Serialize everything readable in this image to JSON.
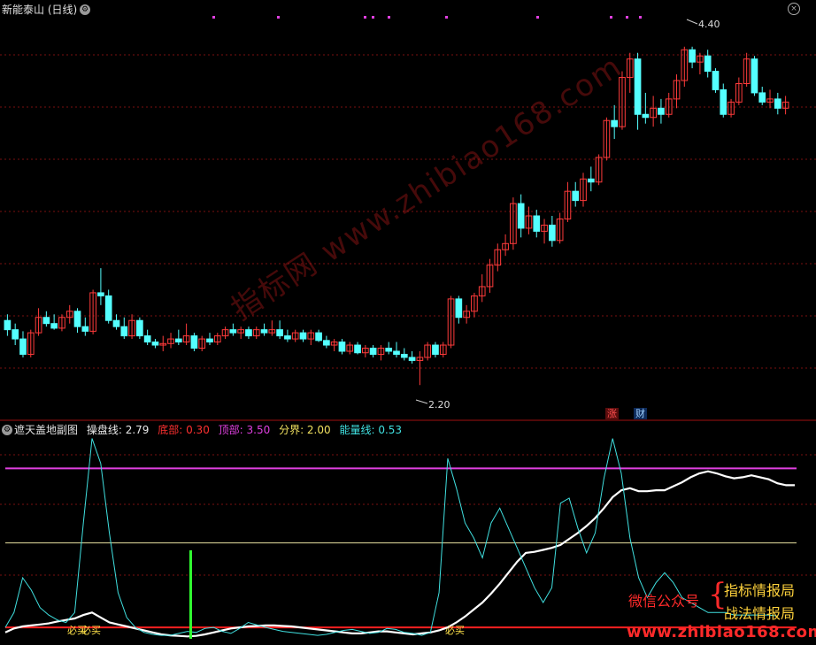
{
  "main_chart": {
    "title": "新能泰山 (日线)",
    "high_label": "4.40",
    "low_label": "2.20",
    "event_tags": [
      "涨",
      "财"
    ],
    "watermark": "指标网 www.zhibiao168.com"
  },
  "sub_chart": {
    "title": "遮天盖地副图",
    "legend": [
      {
        "label": "操盘线: 2.79",
        "color": "#e8e8e8"
      },
      {
        "label": "底部: 0.30",
        "color": "#ff3030"
      },
      {
        "label": "顶部: 3.50",
        "color": "#e040e0"
      },
      {
        "label": "分界: 2.00",
        "color": "#f0e060"
      },
      {
        "label": "能量线: 0.53",
        "color": "#40e0e0"
      }
    ],
    "signals": [
      "必买",
      "必买",
      "必买"
    ],
    "promo": {
      "wechat": "微信公众号",
      "line1": "指标情报局",
      "line2": "战法情报局",
      "url": "www.zhibiao168.com"
    }
  },
  "colors": {
    "up": "#ff3b3b",
    "down": "#54ffff",
    "grid": "#7a1010",
    "top_line": "#e040e0",
    "bottom_line": "#ff2020",
    "mid_line": "#e8e0a0",
    "energy": "#40e0e0",
    "trade_line": "#ffffff",
    "signal_bar": "#30ff30"
  },
  "icons": [
    "gear-icon",
    "close-icon"
  ],
  "chart_data": [
    {
      "type": "candlestick",
      "title": "新能泰山 (日线)",
      "ylim": [
        2.0,
        4.6
      ],
      "annotations": [
        {
          "text": "4.40",
          "value": 4.4
        },
        {
          "text": "2.20",
          "value": 2.2
        }
      ],
      "ohlc": [
        [
          2.62,
          2.66,
          2.52,
          2.56
        ],
        [
          2.56,
          2.6,
          2.46,
          2.5
        ],
        [
          2.5,
          2.55,
          2.38,
          2.4
        ],
        [
          2.4,
          2.56,
          2.38,
          2.54
        ],
        [
          2.54,
          2.7,
          2.52,
          2.64
        ],
        [
          2.64,
          2.68,
          2.58,
          2.6
        ],
        [
          2.6,
          2.66,
          2.56,
          2.57
        ],
        [
          2.57,
          2.66,
          2.55,
          2.64
        ],
        [
          2.64,
          2.72,
          2.6,
          2.68
        ],
        [
          2.68,
          2.7,
          2.54,
          2.58
        ],
        [
          2.58,
          2.64,
          2.52,
          2.55
        ],
        [
          2.55,
          2.82,
          2.53,
          2.8
        ],
        [
          2.8,
          2.96,
          2.72,
          2.78
        ],
        [
          2.78,
          2.82,
          2.6,
          2.62
        ],
        [
          2.62,
          2.66,
          2.56,
          2.58
        ],
        [
          2.58,
          2.64,
          2.5,
          2.52
        ],
        [
          2.52,
          2.66,
          2.5,
          2.62
        ],
        [
          2.62,
          2.64,
          2.5,
          2.52
        ],
        [
          2.52,
          2.56,
          2.46,
          2.48
        ],
        [
          2.48,
          2.5,
          2.44,
          2.46
        ],
        [
          2.46,
          2.52,
          2.42,
          2.47
        ],
        [
          2.47,
          2.54,
          2.44,
          2.5
        ],
        [
          2.5,
          2.56,
          2.46,
          2.48
        ],
        [
          2.48,
          2.6,
          2.46,
          2.52
        ],
        [
          2.52,
          2.54,
          2.42,
          2.44
        ],
        [
          2.44,
          2.52,
          2.42,
          2.5
        ],
        [
          2.5,
          2.54,
          2.46,
          2.48
        ],
        [
          2.48,
          2.54,
          2.46,
          2.52
        ],
        [
          2.52,
          2.58,
          2.5,
          2.56
        ],
        [
          2.56,
          2.6,
          2.52,
          2.54
        ],
        [
          2.54,
          2.58,
          2.5,
          2.56
        ],
        [
          2.56,
          2.58,
          2.5,
          2.52
        ],
        [
          2.52,
          2.58,
          2.5,
          2.56
        ],
        [
          2.56,
          2.6,
          2.52,
          2.54
        ],
        [
          2.54,
          2.62,
          2.52,
          2.56
        ],
        [
          2.56,
          2.62,
          2.5,
          2.52
        ],
        [
          2.52,
          2.56,
          2.48,
          2.5
        ],
        [
          2.5,
          2.56,
          2.48,
          2.54
        ],
        [
          2.54,
          2.56,
          2.48,
          2.5
        ],
        [
          2.5,
          2.56,
          2.46,
          2.54
        ],
        [
          2.54,
          2.56,
          2.48,
          2.49
        ],
        [
          2.49,
          2.52,
          2.44,
          2.46
        ],
        [
          2.46,
          2.5,
          2.42,
          2.48
        ],
        [
          2.48,
          2.5,
          2.4,
          2.42
        ],
        [
          2.42,
          2.48,
          2.4,
          2.46
        ],
        [
          2.46,
          2.48,
          2.4,
          2.41
        ],
        [
          2.41,
          2.46,
          2.38,
          2.44
        ],
        [
          2.44,
          2.46,
          2.38,
          2.4
        ],
        [
          2.4,
          2.46,
          2.36,
          2.44
        ],
        [
          2.44,
          2.48,
          2.4,
          2.42
        ],
        [
          2.42,
          2.48,
          2.38,
          2.4
        ],
        [
          2.4,
          2.44,
          2.36,
          2.38
        ],
        [
          2.38,
          2.42,
          2.34,
          2.36
        ],
        [
          2.36,
          2.42,
          2.2,
          2.38
        ],
        [
          2.38,
          2.48,
          2.36,
          2.46
        ],
        [
          2.46,
          2.48,
          2.38,
          2.4
        ],
        [
          2.4,
          2.48,
          2.38,
          2.46
        ],
        [
          2.46,
          2.78,
          2.44,
          2.76
        ],
        [
          2.76,
          2.78,
          2.6,
          2.64
        ],
        [
          2.64,
          2.72,
          2.6,
          2.68
        ],
        [
          2.68,
          2.8,
          2.64,
          2.78
        ],
        [
          2.78,
          2.92,
          2.74,
          2.84
        ],
        [
          2.84,
          3.02,
          2.8,
          2.98
        ],
        [
          2.98,
          3.12,
          2.94,
          3.08
        ],
        [
          3.08,
          3.18,
          3.04,
          3.12
        ],
        [
          3.12,
          3.42,
          3.08,
          3.38
        ],
        [
          3.38,
          3.44,
          3.16,
          3.22
        ],
        [
          3.22,
          3.36,
          3.18,
          3.3
        ],
        [
          3.3,
          3.34,
          3.16,
          3.2
        ],
        [
          3.2,
          3.28,
          3.12,
          3.24
        ],
        [
          3.24,
          3.3,
          3.1,
          3.14
        ],
        [
          3.14,
          3.32,
          3.12,
          3.28
        ],
        [
          3.28,
          3.52,
          3.26,
          3.46
        ],
        [
          3.46,
          3.52,
          3.36,
          3.4
        ],
        [
          3.4,
          3.58,
          3.36,
          3.54
        ],
        [
          3.54,
          3.62,
          3.46,
          3.52
        ],
        [
          3.52,
          3.7,
          3.5,
          3.68
        ],
        [
          3.68,
          3.94,
          3.66,
          3.92
        ],
        [
          3.92,
          4.02,
          3.8,
          3.88
        ],
        [
          3.88,
          4.24,
          3.86,
          4.2
        ],
        [
          4.2,
          4.36,
          4.1,
          4.32
        ],
        [
          4.32,
          4.36,
          3.86,
          3.96
        ],
        [
          3.96,
          4.1,
          3.9,
          3.94
        ],
        [
          3.94,
          4.08,
          3.88,
          4.0
        ],
        [
          4.0,
          4.06,
          3.9,
          3.96
        ],
        [
          3.96,
          4.1,
          3.94,
          4.06
        ],
        [
          4.06,
          4.22,
          4.0,
          4.18
        ],
        [
          4.18,
          4.4,
          4.14,
          4.38
        ],
        [
          4.38,
          4.4,
          4.26,
          4.3
        ],
        [
          4.3,
          4.36,
          4.22,
          4.34
        ],
        [
          4.34,
          4.38,
          4.2,
          4.24
        ],
        [
          4.24,
          4.26,
          4.1,
          4.12
        ],
        [
          4.12,
          4.16,
          3.94,
          3.96
        ],
        [
          3.96,
          4.06,
          3.94,
          4.04
        ],
        [
          4.04,
          4.2,
          4.02,
          4.16
        ],
        [
          4.16,
          4.36,
          4.14,
          4.32
        ],
        [
          4.32,
          4.34,
          4.08,
          4.1
        ],
        [
          4.1,
          4.14,
          4.02,
          4.04
        ],
        [
          4.04,
          4.12,
          4.0,
          4.06
        ],
        [
          4.06,
          4.1,
          3.96,
          4.0
        ],
        [
          4.0,
          4.08,
          3.96,
          4.04
        ]
      ]
    },
    {
      "type": "line",
      "title": "遮天盖地副图",
      "ylim": [
        0,
        4.2
      ],
      "hlines": [
        {
          "name": "顶部",
          "value": 3.5
        },
        {
          "name": "分界",
          "value": 2.0
        },
        {
          "name": "底部",
          "value": 0.3
        }
      ],
      "series": [
        {
          "name": "操盘线",
          "values": [
            0.2,
            0.28,
            0.32,
            0.34,
            0.36,
            0.38,
            0.42,
            0.45,
            0.48,
            0.55,
            0.6,
            0.5,
            0.4,
            0.36,
            0.32,
            0.28,
            0.24,
            0.2,
            0.16,
            0.14,
            0.13,
            0.12,
            0.13,
            0.16,
            0.2,
            0.24,
            0.28,
            0.3,
            0.32,
            0.33,
            0.34,
            0.34,
            0.33,
            0.32,
            0.3,
            0.28,
            0.26,
            0.24,
            0.22,
            0.2,
            0.18,
            0.18,
            0.2,
            0.22,
            0.22,
            0.2,
            0.18,
            0.16,
            0.18,
            0.2,
            0.24,
            0.3,
            0.4,
            0.52,
            0.66,
            0.8,
            0.98,
            1.18,
            1.4,
            1.62,
            1.8,
            1.82,
            1.86,
            1.9,
            1.96,
            2.08,
            2.2,
            2.34,
            2.5,
            2.7,
            2.92,
            3.06,
            3.1,
            3.04,
            3.04,
            3.06,
            3.06,
            3.14,
            3.22,
            3.32,
            3.4,
            3.44,
            3.4,
            3.34,
            3.3,
            3.32,
            3.36,
            3.32,
            3.28,
            3.2,
            3.16,
            3.16
          ]
        },
        {
          "name": "能量线",
          "values": [
            0.3,
            0.6,
            1.3,
            1.05,
            0.7,
            0.55,
            0.45,
            0.4,
            0.6,
            2.4,
            4.1,
            3.6,
            2.2,
            1.0,
            0.5,
            0.3,
            0.2,
            0.16,
            0.14,
            0.14,
            0.18,
            0.22,
            0.2,
            0.28,
            0.3,
            0.22,
            0.18,
            0.28,
            0.4,
            0.35,
            0.3,
            0.26,
            0.22,
            0.2,
            0.18,
            0.16,
            0.14,
            0.16,
            0.2,
            0.24,
            0.26,
            0.22,
            0.18,
            0.2,
            0.28,
            0.26,
            0.2,
            0.18,
            0.14,
            0.2,
            1.0,
            3.7,
            3.1,
            2.4,
            2.1,
            1.7,
            2.4,
            2.7,
            2.3,
            1.9,
            1.5,
            1.1,
            0.8,
            1.1,
            2.8,
            2.9,
            2.3,
            1.8,
            2.2,
            3.3,
            4.1,
            3.4,
            2.1,
            1.3,
            0.9,
            1.2,
            1.4,
            1.2,
            0.9,
            0.8,
            0.7,
            0.6,
            0.6,
            0.6,
            0.55,
            0.55,
            0.55,
            0.55,
            0.55,
            0.53
          ]
        }
      ]
    }
  ]
}
